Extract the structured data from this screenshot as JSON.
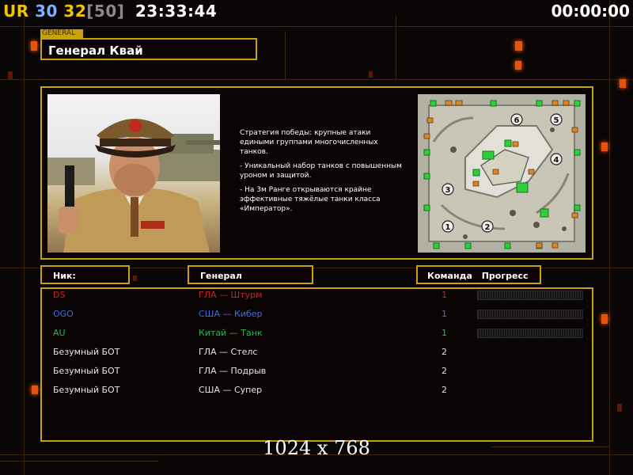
{
  "hud": {
    "ur": "UR",
    "val_a": "30",
    "val_b": "32",
    "limit": "[50]",
    "clock": "23:33:44",
    "timer": "00:00:00"
  },
  "general": {
    "tag": "GENERAL",
    "name": "Генерал Квай"
  },
  "strategy": {
    "line1": "Стратегия победы: крупные атаки едиными группами многочисленных танков.",
    "line2": "- Уникальный набор танков с повышенным уроном и защитой.",
    "line3": "- На 3м Ранге открываются крайне эффективные тяжёлые танки класса «Император»."
  },
  "map": {
    "slots": [
      "1",
      "2",
      "3",
      "4",
      "5",
      "6"
    ]
  },
  "columns": {
    "nick": "Ник:",
    "general": "Генерал",
    "team": "Команда",
    "progress": "Прогресс"
  },
  "players": [
    {
      "nick": "DS",
      "general": "ГЛА — Штурм",
      "team": "1",
      "color": "#c8261c",
      "progress": true
    },
    {
      "nick": "OGO",
      "general": "США — Кибер",
      "team": "1",
      "color": "#3f6fe0",
      "progress": true
    },
    {
      "nick": "AU",
      "general": "Китай — Танк",
      "team": "1",
      "color": "#29b84a",
      "progress": true
    },
    {
      "nick": "Безумный БОТ",
      "general": "ГЛА — Стелс",
      "team": "2",
      "color": "#e6e6e6",
      "progress": false
    },
    {
      "nick": "Безумный БОТ",
      "general": "ГЛА — Подрыв",
      "team": "2",
      "color": "#e6e6e6",
      "progress": false
    },
    {
      "nick": "Безумный БОТ",
      "general": "США — Супер",
      "team": "2",
      "color": "#e6e6e6",
      "progress": false
    }
  ],
  "resolution": "1024 x 768",
  "colors": {
    "accent": "#c7a10e",
    "glow": "#e8520f"
  }
}
